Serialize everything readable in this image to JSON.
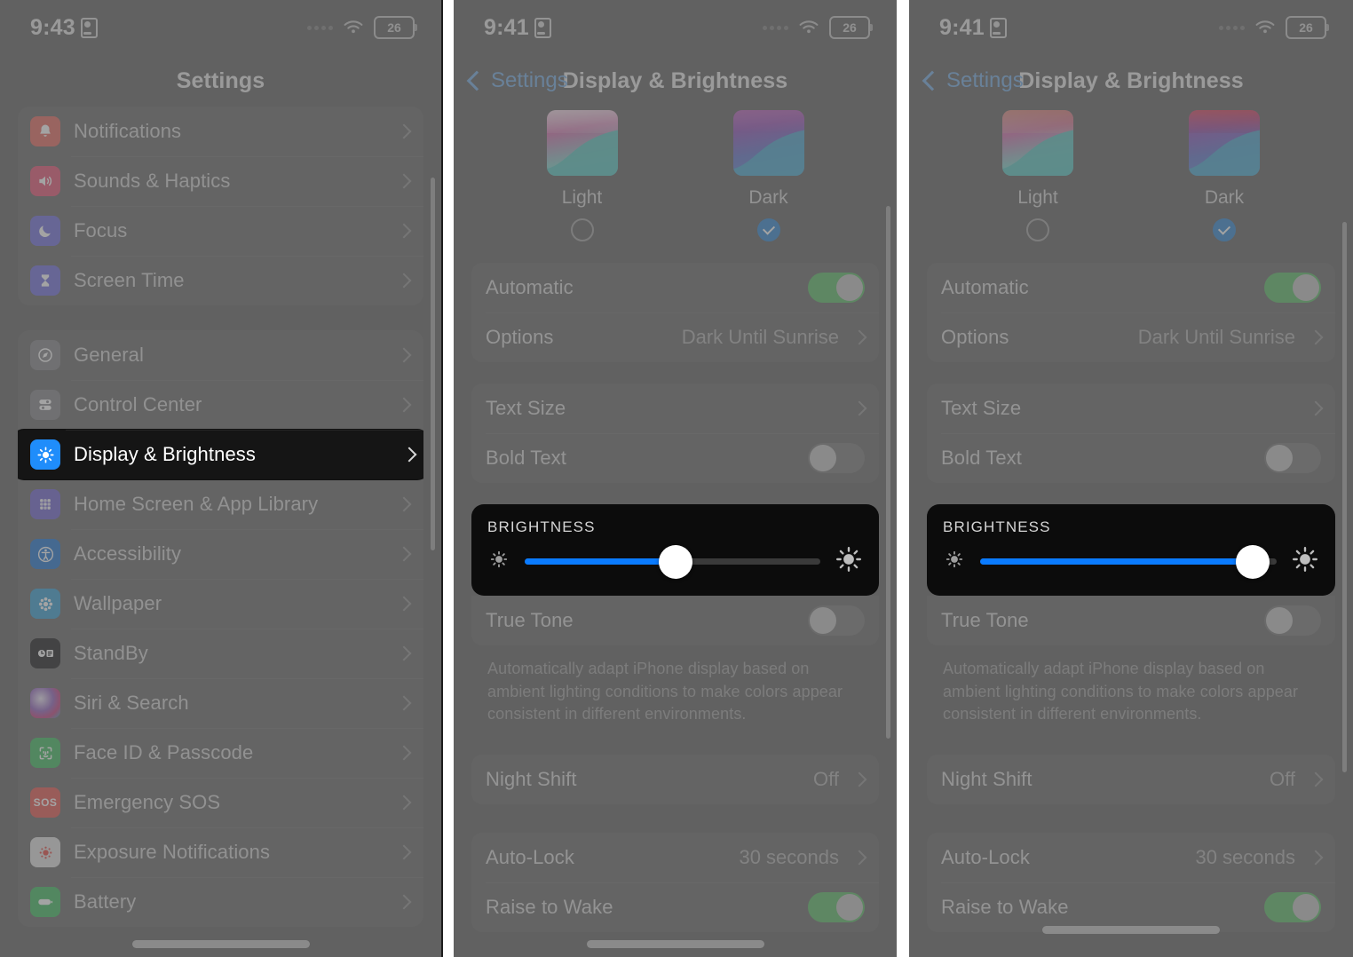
{
  "panels": [
    {
      "id": "settings-list",
      "status_bar": {
        "time": "9:43",
        "battery": "26",
        "lock_icon": "lock-portrait-icon",
        "wifi_icon": "wifi-icon",
        "dots_icon": "signal-dots-icon"
      },
      "nav": {
        "title": "Settings"
      },
      "groups": [
        {
          "rows": [
            {
              "label": "Notifications",
              "icon": "notifications-icon",
              "color": "#e8736a",
              "glyph": "◎"
            },
            {
              "label": "Sounds & Haptics",
              "icon": "sounds-haptics-icon",
              "color": "#e8607f",
              "glyph": "◀"
            },
            {
              "label": "Focus",
              "icon": "focus-icon",
              "color": "#7b79e0",
              "glyph": "☾"
            },
            {
              "label": "Screen Time",
              "icon": "screen-time-icon",
              "color": "#7b79e0",
              "glyph": "⧗"
            }
          ]
        },
        {
          "rows": [
            {
              "label": "General",
              "icon": "general-icon",
              "color": "#8e8e93",
              "glyph": "⚙"
            },
            {
              "label": "Control Center",
              "icon": "control-center-icon",
              "color": "#8e8e93",
              "glyph": "☰"
            },
            {
              "label": "Display & Brightness",
              "icon": "display-brightness-icon",
              "color": "#1f8dfb",
              "glyph": "☀",
              "highlighted": true
            },
            {
              "label": "Home Screen & App Library",
              "icon": "home-screen-icon",
              "color": "#7b6fd6",
              "glyph": "∷"
            },
            {
              "label": "Accessibility",
              "icon": "accessibility-icon",
              "color": "#2f7fd6",
              "glyph": "♿"
            },
            {
              "label": "Wallpaper",
              "icon": "wallpaper-icon",
              "color": "#46a7d8",
              "glyph": "❀"
            },
            {
              "label": "StandBy",
              "icon": "standby-icon",
              "color": "#2c2c2e",
              "glyph": "◔"
            },
            {
              "label": "Siri & Search",
              "icon": "siri-search-icon",
              "color": "#9b6fc4",
              "glyph": "◉"
            },
            {
              "label": "Face ID & Passcode",
              "icon": "face-id-icon",
              "color": "#4dc26b",
              "glyph": "☺"
            },
            {
              "label": "Emergency SOS",
              "icon": "emergency-sos-icon",
              "color": "#e8625c",
              "glyph": "SOS"
            },
            {
              "label": "Exposure Notifications",
              "icon": "exposure-notifications-icon",
              "color": "#e8e8e8",
              "glyph": "●"
            },
            {
              "label": "Battery",
              "icon": "battery-icon",
              "color": "#4dc26b",
              "glyph": "▬"
            }
          ]
        }
      ]
    },
    {
      "id": "display-brightness-mid",
      "status_bar": {
        "time": "9:41",
        "battery": "26",
        "lock_icon": "lock-portrait-icon",
        "wifi_icon": "wifi-icon",
        "dots_icon": "signal-dots-icon"
      },
      "nav": {
        "back_label": "Settings",
        "title": "Display & Brightness"
      },
      "appearance": {
        "options": [
          {
            "label": "Light",
            "selected": false,
            "tint": "none"
          },
          {
            "label": "Dark",
            "selected": true,
            "tint": "none"
          }
        ]
      },
      "appearance_card": [
        {
          "type": "switch",
          "label": "Automatic",
          "on": true
        },
        {
          "type": "value",
          "label": "Options",
          "value": "Dark Until Sunrise"
        }
      ],
      "text_card": [
        {
          "type": "link",
          "label": "Text Size"
        },
        {
          "type": "switch",
          "label": "Bold Text",
          "on": false
        }
      ],
      "brightness": {
        "header": "BRIGHTNESS",
        "level_percent": 51,
        "highlighted": true,
        "low_icon": "sun-low-icon",
        "high_icon": "sun-high-icon"
      },
      "true_tone": {
        "label": "True Tone",
        "on": false,
        "footnote": "Automatically adapt iPhone display based on ambient lighting conditions to make colors appear consistent in different environments."
      },
      "night_shift": {
        "label": "Night Shift",
        "value": "Off"
      },
      "lock_card": [
        {
          "type": "value",
          "label": "Auto-Lock",
          "value": "30 seconds"
        },
        {
          "type": "switch",
          "label": "Raise to Wake",
          "on": true
        }
      ]
    },
    {
      "id": "display-brightness-max",
      "status_bar": {
        "time": "9:41",
        "battery": "26",
        "lock_icon": "lock-portrait-icon",
        "wifi_icon": "wifi-icon",
        "dots_icon": "signal-dots-icon"
      },
      "nav": {
        "back_label": "Settings",
        "title": "Display & Brightness"
      },
      "appearance": {
        "options": [
          {
            "label": "Light",
            "selected": false,
            "tint": "warm"
          },
          {
            "label": "Dark",
            "selected": true,
            "tint": "warm"
          }
        ]
      },
      "appearance_card": [
        {
          "type": "switch",
          "label": "Automatic",
          "on": true
        },
        {
          "type": "value",
          "label": "Options",
          "value": "Dark Until Sunrise"
        }
      ],
      "text_card": [
        {
          "type": "link",
          "label": "Text Size"
        },
        {
          "type": "switch",
          "label": "Bold Text",
          "on": false
        }
      ],
      "brightness": {
        "header": "BRIGHTNESS",
        "level_percent": 92,
        "highlighted": true,
        "low_icon": "sun-low-icon",
        "high_icon": "sun-high-icon"
      },
      "true_tone": {
        "label": "True Tone",
        "on": false,
        "footnote": "Automatically adapt iPhone display based on ambient lighting conditions to make colors appear consistent in different environments."
      },
      "night_shift": {
        "label": "Night Shift",
        "value": "Off"
      },
      "lock_card": [
        {
          "type": "value",
          "label": "Auto-Lock",
          "value": "30 seconds"
        },
        {
          "type": "switch",
          "label": "Raise to Wake",
          "on": true
        }
      ]
    }
  ],
  "colors": {
    "accent_blue": "#0a7bff",
    "switch_green": "#67c071",
    "selection_blue": "#3f8fd4",
    "highlight_bg": "#0c0c0c"
  }
}
